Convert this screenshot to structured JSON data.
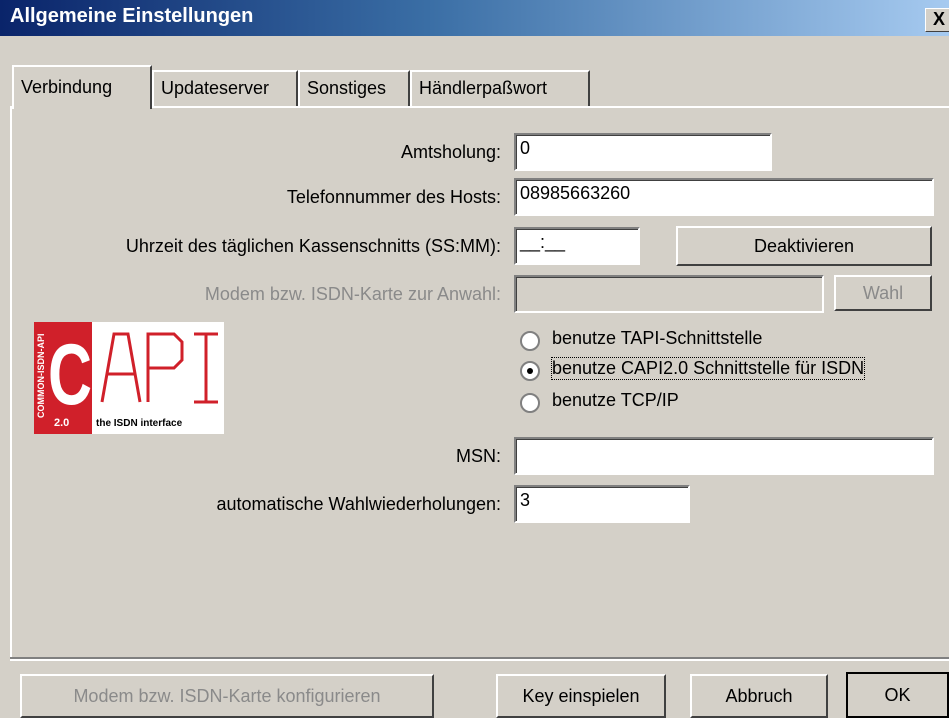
{
  "window": {
    "title": "Allgemeine Einstellungen",
    "close_glyph": "X"
  },
  "tabs": [
    {
      "label": "Verbindung",
      "active": true
    },
    {
      "label": "Updateserver",
      "active": false
    },
    {
      "label": "Sonstiges",
      "active": false
    },
    {
      "label": "Händlerpaßwort",
      "active": false
    }
  ],
  "fields": {
    "amtsholung": {
      "label": "Amtsholung:",
      "value": "0"
    },
    "telefon": {
      "label": "Telefonnummer des Hosts:",
      "value": "08985663260"
    },
    "uhrzeit": {
      "label": "Uhrzeit des täglichen Kassenschnitts (SS:MM):",
      "value": "__:__"
    },
    "modem": {
      "label": "Modem bzw. ISDN-Karte zur Anwahl:",
      "value": ""
    },
    "msn": {
      "label": "MSN:",
      "value": ""
    },
    "wahlwiederholungen": {
      "label": "automatische Wahlwiederholungen:",
      "value": "3"
    }
  },
  "buttons": {
    "deaktivieren": "Deaktivieren",
    "wahl": "Wahl",
    "modem_konfigurieren": "Modem bzw. ISDN-Karte konfigurieren",
    "key_einspielen": "Key einspielen",
    "abbruch": "Abbruch",
    "ok": "OK"
  },
  "radios": [
    {
      "label": "benutze TAPI-Schnittstelle",
      "selected": false
    },
    {
      "label": "benutze CAPI2.0 Schnittstelle für ISDN",
      "selected": true
    },
    {
      "label": "benutze TCP/IP",
      "selected": false
    }
  ],
  "logo": {
    "big_text": "CAPI",
    "side_text": "COMMON-ISDN-API",
    "version": "2.0",
    "tagline": "the ISDN interface",
    "accent_color": "#d0202a"
  },
  "colors": {
    "titlebar_start": "#0a246a",
    "titlebar_end": "#a6caf0",
    "face": "#d4d0c8"
  }
}
